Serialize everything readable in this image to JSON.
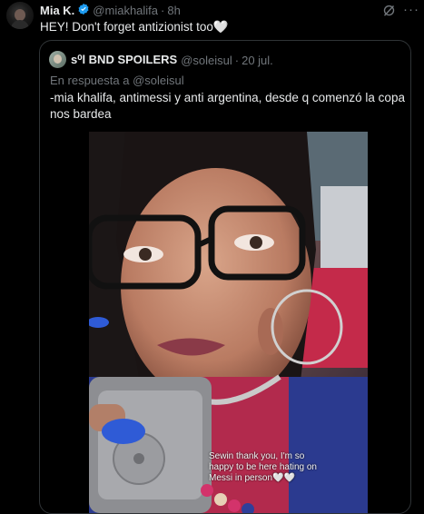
{
  "tweet": {
    "author_name": "Mia K.",
    "handle": "@miakhalifa",
    "separator": "·",
    "time": "8h",
    "text": "HEY! Don't forget antizionist too🤍",
    "more_label": "···"
  },
  "quoted_tweet": {
    "author_name": "s⁰l BND SPOILERS",
    "handle": "@soleisul",
    "separator": "·",
    "time": "20 jul.",
    "reply_prefix": "En respuesta a",
    "reply_handle": "@soleisul",
    "text": "-mia khalifa, antimessi y anti argentina, desde q comenzó la copa nos bardea"
  },
  "video": {
    "caption_line1": "Sewin thank you, I'm so",
    "caption_line2": "happy to be here hating on",
    "caption_line3": "Messi in person🤍🤍"
  },
  "colors": {
    "background": "#000000",
    "text_primary": "#e7e9ea",
    "text_secondary": "#71767b",
    "verified": "#1d9bf0",
    "border": "#2f3336"
  },
  "icons": [
    "verified-badge-icon",
    "grok-icon",
    "more-icon"
  ]
}
